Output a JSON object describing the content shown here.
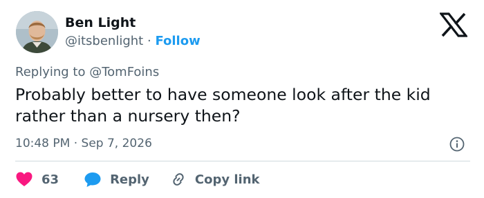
{
  "author": {
    "name": "Ben Light",
    "handle": "@itsbenlight",
    "separator": "·",
    "follow_label": "Follow"
  },
  "reply_context": {
    "prefix": "Replying to",
    "mention": "@TomFoins"
  },
  "tweet": {
    "text": "Probably better to have someone look after the kid rather than a nursery then?",
    "time": "10:48 PM",
    "separator": "·",
    "date": "Sep 7, 2026"
  },
  "actions": {
    "like_count": "63",
    "reply_label": "Reply",
    "copy_label": "Copy link"
  },
  "colors": {
    "accent": "#1d9bf0",
    "like": "#f91880",
    "muted": "#536471",
    "text": "#0f1419"
  },
  "icons": [
    "x-logo-icon",
    "info-icon",
    "heart-icon",
    "reply-bubble-icon",
    "link-icon"
  ]
}
